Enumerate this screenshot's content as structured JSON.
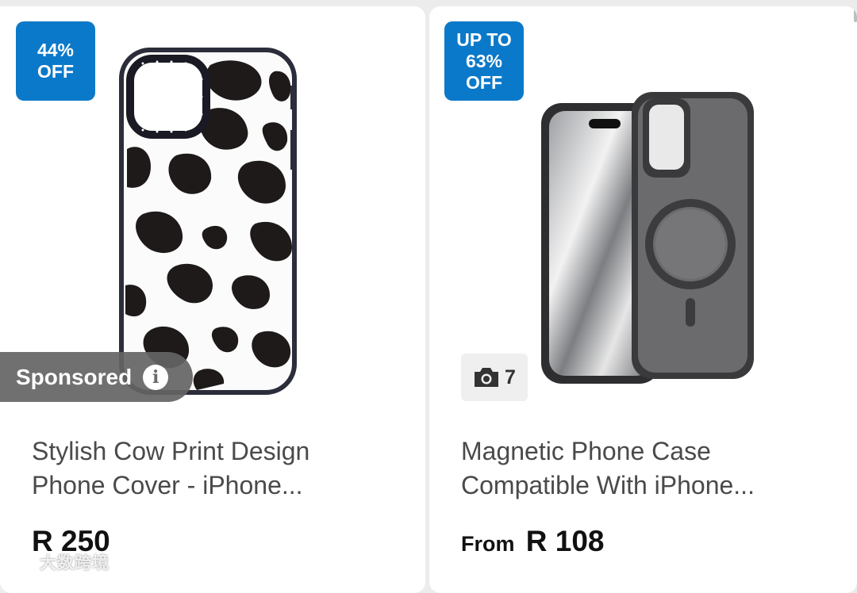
{
  "products": [
    {
      "badge_lines": [
        "44%",
        "OFF"
      ],
      "image_icon": "cow-print-phone-case",
      "sponsored_label": "Sponsored",
      "title_lines": [
        "Stylish Cow Print Design",
        "Phone Cover - iPhone..."
      ],
      "price": "R 250"
    },
    {
      "badge_lines": [
        "UP TO",
        "63%",
        "OFF"
      ],
      "image_icon": "magnetic-phone-case",
      "photo_count": "7",
      "title_lines": [
        "Magnetic Phone Case",
        "Compatible With iPhone..."
      ],
      "price_prefix": "From",
      "price": "R 108"
    }
  ],
  "watermark": {
    "text": "大数跨境",
    "icon": "watermark-logo-icon"
  },
  "colors": {
    "badge": "#0b79c9",
    "sponsored_bg": "#646464",
    "title": "#4a4a4a",
    "price": "#111111",
    "page_bg": "#ececec"
  }
}
